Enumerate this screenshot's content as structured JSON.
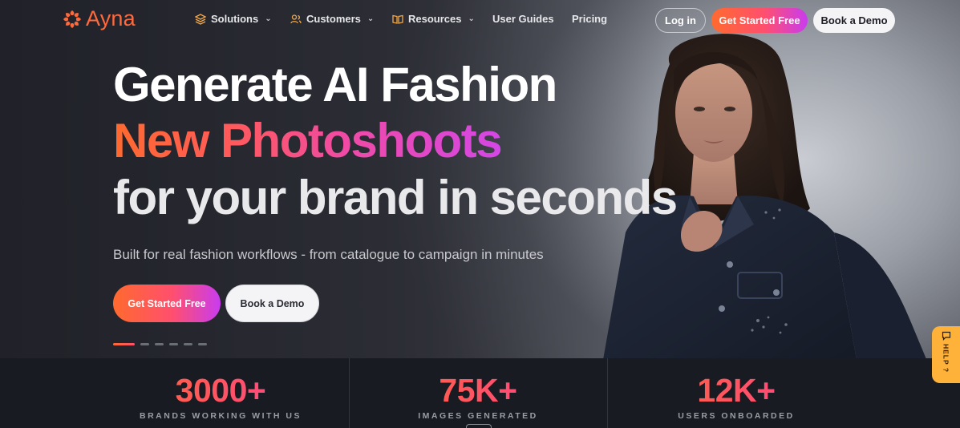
{
  "brand": {
    "name": "Ayna",
    "accent": "#ff6a3d"
  },
  "nav": {
    "items": [
      {
        "label": "Solutions",
        "icon": "layers-icon",
        "dropdown": true
      },
      {
        "label": "Customers",
        "icon": "users-icon",
        "dropdown": true
      },
      {
        "label": "Resources",
        "icon": "book-open-icon",
        "dropdown": true
      },
      {
        "label": "User Guides",
        "icon": "",
        "dropdown": false
      },
      {
        "label": "Pricing",
        "icon": "",
        "dropdown": false
      }
    ],
    "login_label": "Log in",
    "start_label": "Get Started Free",
    "demo_label": "Book a Demo"
  },
  "hero": {
    "line1": "Generate AI Fashion",
    "line2": "New Photoshoots",
    "line3": "for your brand in seconds",
    "subtitle": "Built for real fashion workflows - from catalogue to campaign in minutes",
    "cta_start": "Get Started Free",
    "cta_demo": "Book a Demo",
    "carousel": {
      "slides": 6,
      "active": 1
    }
  },
  "stats": [
    {
      "value": "3000+",
      "label": "BRANDS WORKING WITH US"
    },
    {
      "value": "75K+",
      "label": "IMAGES GENERATED"
    },
    {
      "value": "12K+",
      "label": "USERS ONBOARDED"
    }
  ],
  "help": {
    "label": "HELP ?"
  },
  "colors": {
    "gradient_start": "#ff6a2e",
    "gradient_mid": "#ff4f6e",
    "gradient_end": "#c93cf0",
    "help_tab": "#ffb23a"
  }
}
